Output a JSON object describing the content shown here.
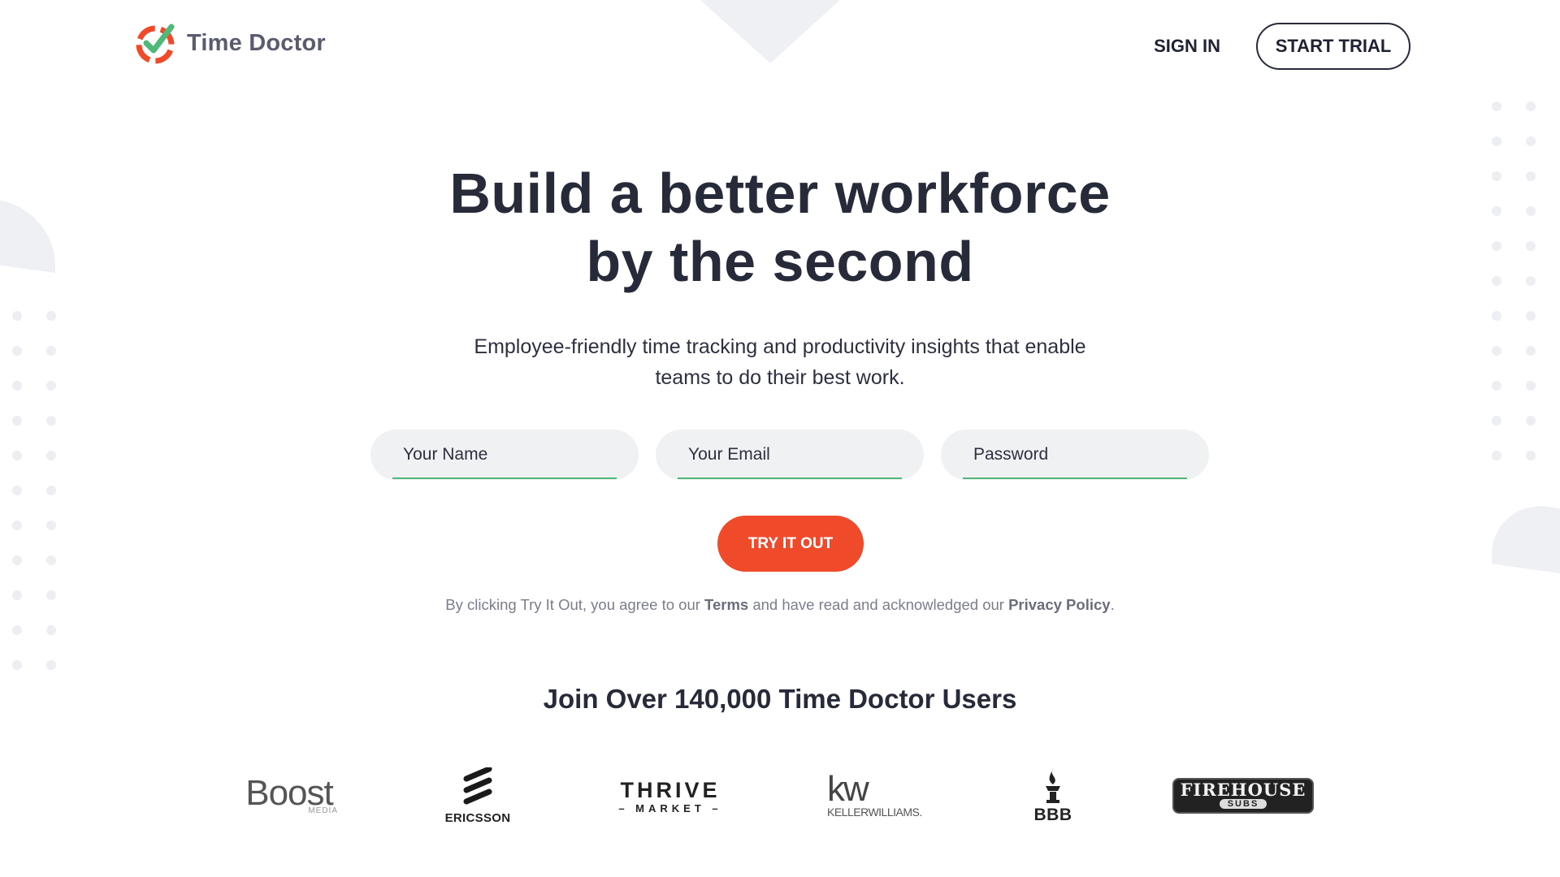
{
  "brand": {
    "name": "Time Doctor",
    "colors": {
      "accent": "#ef4a2a",
      "check": "#4fb97a",
      "text_dark": "#272a39"
    }
  },
  "nav": {
    "sign_in": "SIGN IN",
    "start_trial": "START TRIAL"
  },
  "hero": {
    "headline_line1": "Build a better workforce",
    "headline_line2": "by the second",
    "subhead_line1": "Employee-friendly time tracking and productivity insights that enable",
    "subhead_line2": "teams to do their best work."
  },
  "form": {
    "name_placeholder": "Your Name",
    "email_placeholder": "Your Email",
    "password_placeholder": "Password",
    "submit_label": "TRY IT OUT"
  },
  "disclaimer": {
    "prefix": "By clicking Try It Out, you agree to our ",
    "terms": "Terms",
    "middle": " and have read and acknowledged our ",
    "privacy": "Privacy Policy",
    "suffix": "."
  },
  "social_proof": {
    "heading": "Join Over 140,000 Time Doctor Users",
    "clients": [
      {
        "name": "boost-media-logo",
        "main": "Boost",
        "sub": "MEDIA"
      },
      {
        "name": "ericsson-logo",
        "main": "ERICSSON"
      },
      {
        "name": "thrive-market-logo",
        "main": "THRIVE",
        "sub": "– MARKET –"
      },
      {
        "name": "keller-williams-logo",
        "main": "kw",
        "sub": "KELLERWILLIAMS."
      },
      {
        "name": "bbb-logo",
        "main": "BBB"
      },
      {
        "name": "firehouse-subs-logo",
        "main": "FIREHOUSE",
        "sub": "SUBS"
      }
    ]
  }
}
